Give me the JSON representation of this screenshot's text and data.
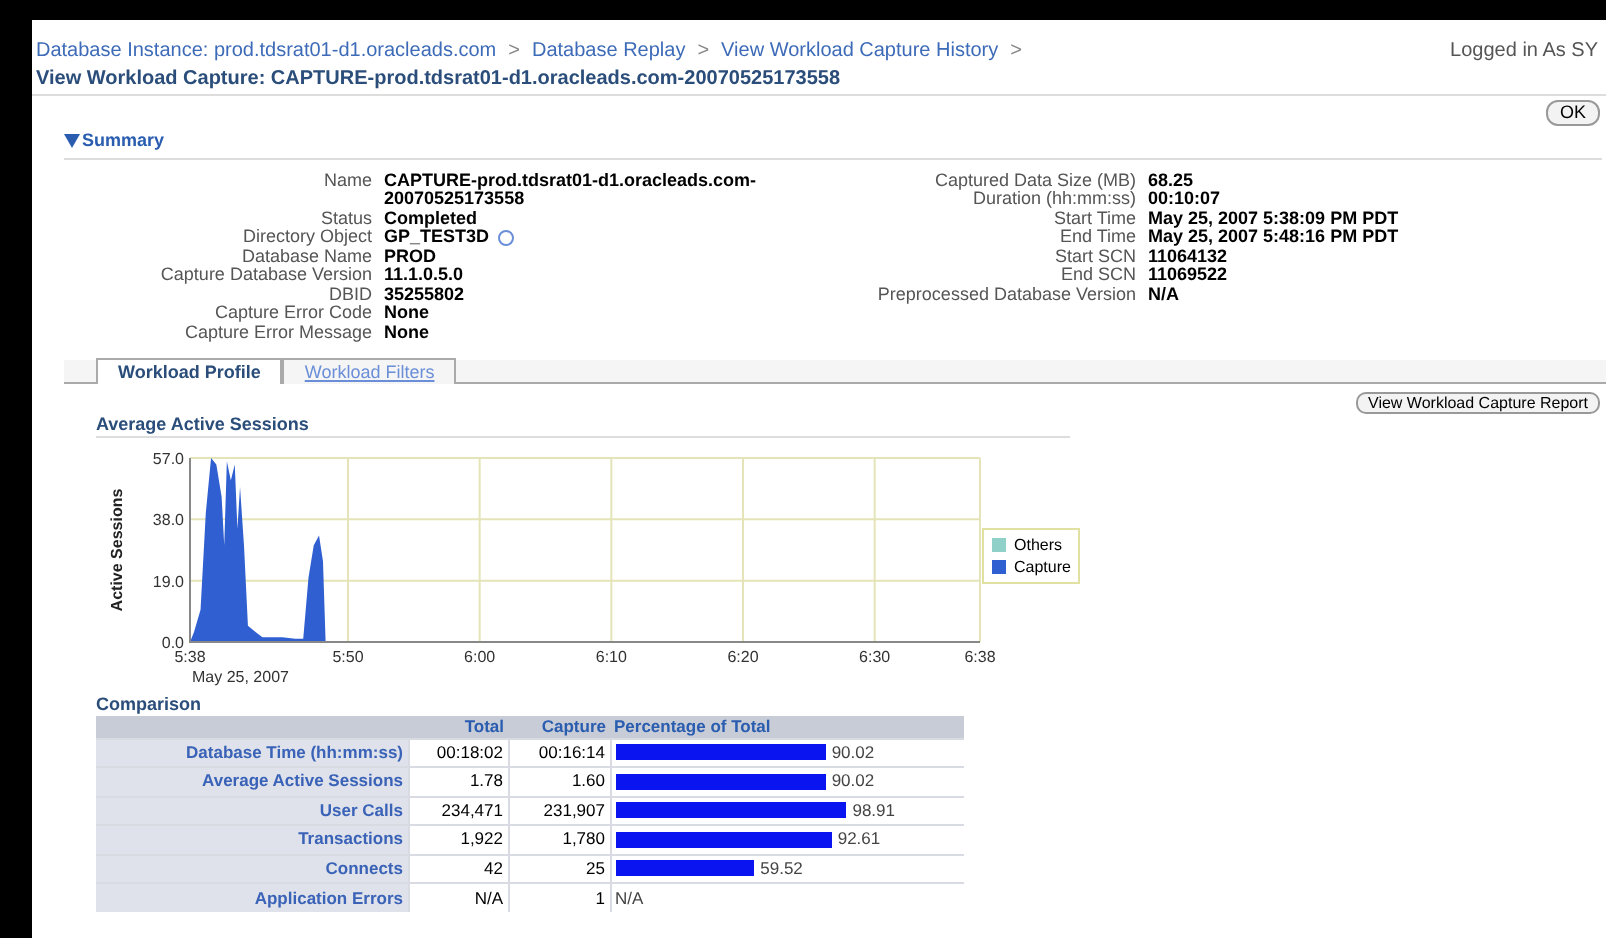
{
  "breadcrumbs": [
    {
      "label": "Database Instance: prod.tdsrat01-d1.oracleads.com",
      "separator": ">"
    },
    {
      "label": "Database Replay",
      "separator": ">"
    },
    {
      "label": "View Workload Capture History",
      "separator": ">"
    }
  ],
  "logged_in": "Logged in As SY",
  "page_title": "View Workload Capture: CAPTURE-prod.tdsrat01-d1.oracleads.com-20070525173558",
  "ok_button": "OK",
  "summary": {
    "title": "Summary",
    "expanded": true,
    "left": [
      {
        "label": "Name",
        "value": "CAPTURE-prod.tdsrat01-d1.oracleads.com-20070525173558"
      },
      {
        "label": "Status",
        "value": "Completed"
      },
      {
        "label": "Directory Object",
        "value": "GP_TEST3D",
        "info": true
      },
      {
        "label": "Database Name",
        "value": "PROD"
      },
      {
        "label": "Capture Database Version",
        "value": "11.1.0.5.0"
      },
      {
        "label": "DBID",
        "value": "35255802"
      },
      {
        "label": "Capture Error Code",
        "value": "None"
      },
      {
        "label": "Capture Error Message",
        "value": "None"
      }
    ],
    "right": [
      {
        "label": "Captured Data Size (MB)",
        "value": "68.25"
      },
      {
        "label": "Duration (hh:mm:ss)",
        "value": "00:10:07"
      },
      {
        "label": "Start Time",
        "value": "May 25, 2007 5:38:09 PM PDT"
      },
      {
        "label": "End Time",
        "value": "May 25, 2007 5:48:16 PM PDT"
      },
      {
        "label": "Start SCN",
        "value": "11064132"
      },
      {
        "label": "End SCN",
        "value": "11069522"
      },
      {
        "label": "Preprocessed Database Version",
        "value": "N/A"
      }
    ]
  },
  "tabs": [
    {
      "label": "Workload Profile",
      "selected": true
    },
    {
      "label": "Workload Filters",
      "selected": false
    }
  ],
  "report_button": "View Workload Capture Report",
  "sessions": {
    "title": "Average Active Sessions",
    "chart_data": {
      "type": "area",
      "grid": true,
      "ylabel": "Active Sessions",
      "xlabel": "May 25, 2007",
      "x": [
        338,
        338.3,
        338.8,
        339.2,
        339.6,
        340,
        340.4,
        340.6,
        340.8,
        341.1,
        341.4,
        341.6,
        341.8,
        342.1,
        342.4,
        343,
        343.5,
        345,
        346,
        346.6,
        347,
        347.4,
        347.8,
        348.1,
        348.3
      ],
      "series": [
        {
          "name": "Others",
          "color": "#8fd1c8",
          "values": [
            null,
            null,
            null,
            null,
            null,
            null,
            null,
            null,
            null,
            null,
            null,
            null,
            null,
            null,
            null,
            null,
            null,
            null,
            null,
            null,
            null,
            null,
            null,
            null,
            null
          ]
        },
        {
          "name": "Capture",
          "color": "#2f5fd0",
          "values": [
            0,
            3,
            10,
            40,
            57,
            55,
            45,
            30,
            56,
            50,
            55,
            35,
            48,
            30,
            5,
            3,
            1.5,
            1.5,
            1,
            1,
            20,
            30,
            33,
            25,
            0
          ]
        }
      ],
      "xlim": [
        338,
        398
      ],
      "ylim": [
        0,
        57
      ],
      "xticks": [
        {
          "value": 338,
          "label": "5:38"
        },
        {
          "value": 350,
          "label": "5:50"
        },
        {
          "value": 360,
          "label": "6:00"
        },
        {
          "value": 370,
          "label": "6:10"
        },
        {
          "value": 380,
          "label": "6:20"
        },
        {
          "value": 390,
          "label": "6:30"
        },
        {
          "value": 398,
          "label": "6:38"
        }
      ],
      "yticks": [
        {
          "value": 0,
          "label": "0.0"
        },
        {
          "value": 19,
          "label": "19.0"
        },
        {
          "value": 38,
          "label": "38.0"
        },
        {
          "value": 57,
          "label": "57.0"
        }
      ]
    }
  },
  "comparison": {
    "title": "Comparison",
    "columns": [
      "Total",
      "Capture",
      "Percentage of Total"
    ],
    "rows": [
      {
        "label": "Database Time (hh:mm:ss)",
        "total": "00:18:02",
        "capture": "00:16:14",
        "percent": "90.02"
      },
      {
        "label": "Average Active Sessions",
        "total": "1.78",
        "capture": "1.60",
        "percent": "90.02"
      },
      {
        "label": "User Calls",
        "total": "234,471",
        "capture": "231,907",
        "percent": "98.91"
      },
      {
        "label": "Transactions",
        "total": "1,922",
        "capture": "1,780",
        "percent": "92.61"
      },
      {
        "label": "Connects",
        "total": "42",
        "capture": "25",
        "percent": "59.52"
      },
      {
        "label": "Application Errors",
        "total": "N/A",
        "capture": "1",
        "percent": "N/A"
      }
    ]
  }
}
